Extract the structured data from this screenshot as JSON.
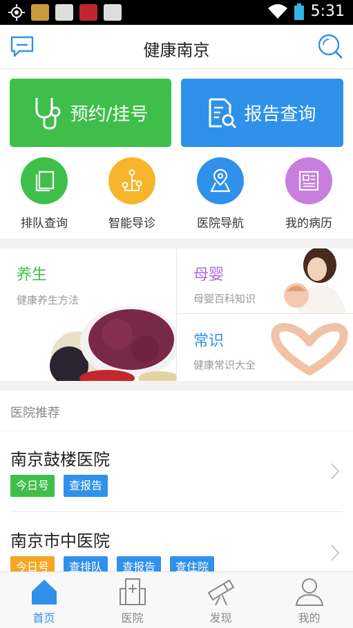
{
  "status_bar": {
    "time": "5:31",
    "notification_icons": [
      "gps-icon",
      "app-icon",
      "app-icon",
      "app-icon",
      "app-icon"
    ],
    "wifi_icon": "wifi-icon",
    "battery_icon": "battery-icon"
  },
  "header": {
    "title": "健康南京",
    "left_icon": "message-icon",
    "right_icon": "search-icon"
  },
  "primary_actions": [
    {
      "label": "预约/挂号",
      "icon": "stethoscope-icon",
      "color": "#3fbf4a"
    },
    {
      "label": "报告查询",
      "icon": "report-search-icon",
      "color": "#2f91ea"
    }
  ],
  "quick_actions": [
    {
      "label": "排队查询",
      "icon": "queue-icon",
      "color": "#3fbf4a"
    },
    {
      "label": "智能导诊",
      "icon": "guide-icon",
      "color": "#f7b52c"
    },
    {
      "label": "医院导航",
      "icon": "map-pin-icon",
      "color": "#2f91ea"
    },
    {
      "label": "我的病历",
      "icon": "record-icon",
      "color": "#c87ede"
    }
  ],
  "health_cards": {
    "wellness": {
      "title": "养生",
      "subtitle": "健康养生方法",
      "color": "#3fbf4a"
    },
    "maternal": {
      "title": "母婴",
      "subtitle": "母婴百科知识",
      "color": "#b06ad6"
    },
    "common": {
      "title": "常识",
      "subtitle": "健康常识大全",
      "color": "#2f91ea"
    }
  },
  "recommend": {
    "heading": "医院推荐",
    "hospitals": [
      {
        "name": "南京鼓楼医院",
        "tags": [
          {
            "label": "今日号",
            "color": "green"
          },
          {
            "label": "查报告",
            "color": "blue"
          }
        ]
      },
      {
        "name": "南京市中医院",
        "tags": [
          {
            "label": "今日号",
            "color": "orange"
          },
          {
            "label": "查排队",
            "color": "blue"
          },
          {
            "label": "查报告",
            "color": "blue"
          },
          {
            "label": "查住院",
            "color": "blue"
          }
        ]
      }
    ]
  },
  "tabs": [
    {
      "label": "首页",
      "icon": "home-icon",
      "active": true
    },
    {
      "label": "医院",
      "icon": "hospital-icon",
      "active": false
    },
    {
      "label": "发现",
      "icon": "telescope-icon",
      "active": false
    },
    {
      "label": "我的",
      "icon": "user-icon",
      "active": false
    }
  ],
  "colors": {
    "accent": "#2f91ea",
    "green": "#3fbf4a",
    "inactive": "#888888"
  }
}
